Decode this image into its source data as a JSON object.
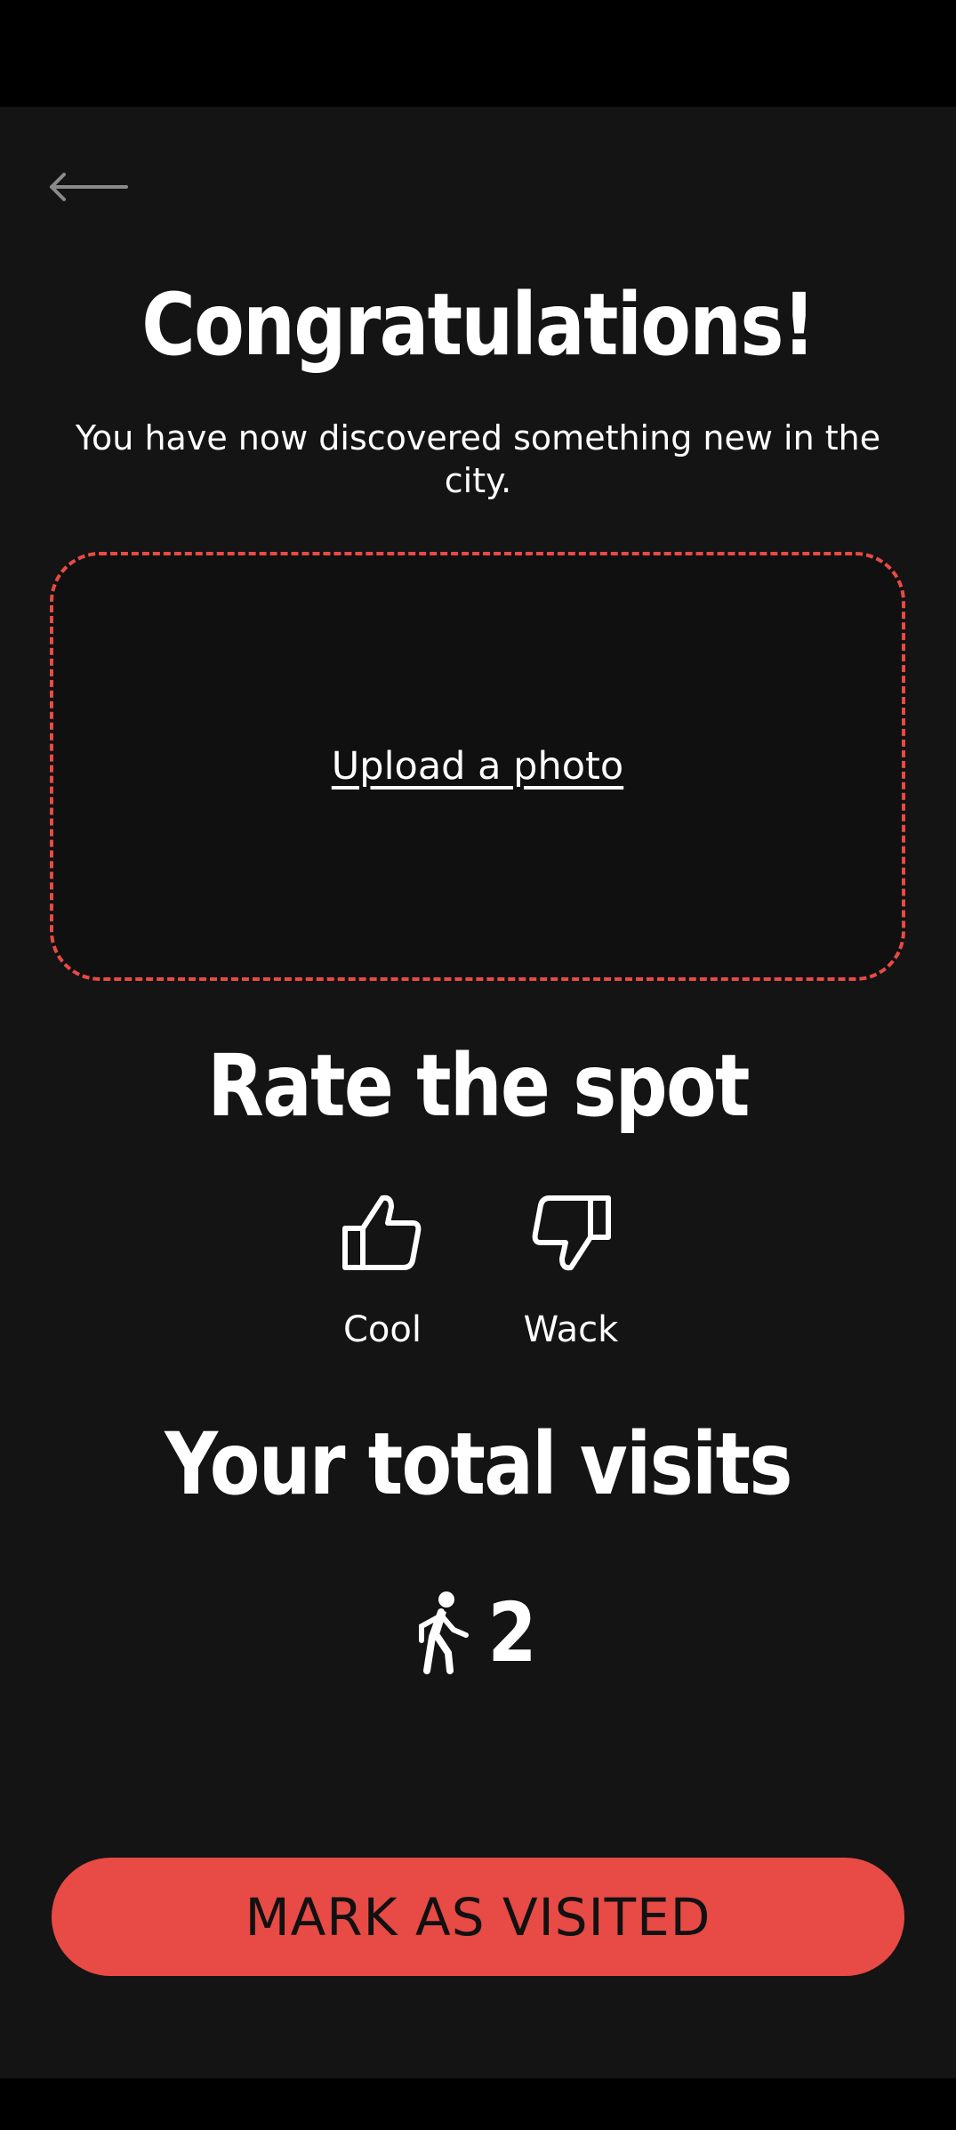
{
  "header": {
    "back_icon": "arrow-left-icon"
  },
  "main": {
    "title": "Congratulations!",
    "subtitle": "You have now discovered something new in the city.",
    "upload": {
      "label": "Upload a photo"
    },
    "rating": {
      "title": "Rate the spot",
      "options": [
        {
          "label": "Cool",
          "icon": "thumbs-up-icon"
        },
        {
          "label": "Wack",
          "icon": "thumbs-down-icon"
        }
      ]
    },
    "visits": {
      "title": "Your total visits",
      "count": "2",
      "icon": "walking-person-icon"
    }
  },
  "footer": {
    "button_label": "MARK AS VISITED"
  },
  "colors": {
    "accent": "#e84a45",
    "background": "#141414",
    "text": "#ffffff"
  }
}
